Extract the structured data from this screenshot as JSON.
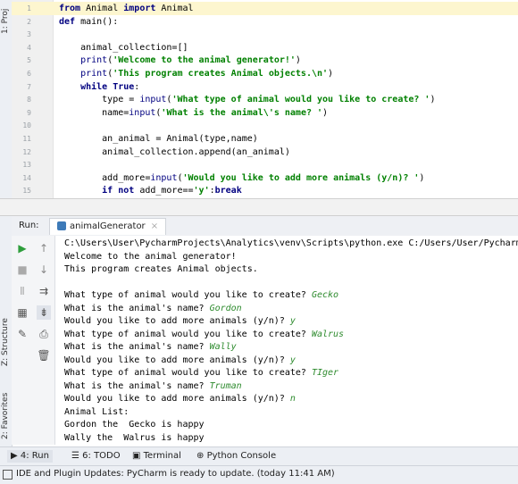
{
  "left_tabs": {
    "project": "1: Proj",
    "structure": "Z: Structure",
    "favorites": "2: Favorites"
  },
  "editor": {
    "lines": [
      {
        "num": "1",
        "parts": [
          [
            "kw",
            "from "
          ],
          [
            "",
            "Animal "
          ],
          [
            "kw",
            "import "
          ],
          [
            "",
            "Animal"
          ]
        ],
        "highlight": true
      },
      {
        "num": "2",
        "parts": [
          [
            "kw",
            "def "
          ],
          [
            "",
            "main():"
          ]
        ]
      },
      {
        "num": "3",
        "parts": []
      },
      {
        "num": "4",
        "parts": [
          [
            "",
            "    animal_collection=[]"
          ]
        ]
      },
      {
        "num": "5",
        "parts": [
          [
            "fn",
            "    print"
          ],
          [
            "",
            "("
          ],
          [
            "str",
            "'Welcome to the animal generator!'"
          ],
          [
            "",
            ")"
          ]
        ]
      },
      {
        "num": "6",
        "parts": [
          [
            "fn",
            "    print"
          ],
          [
            "",
            "("
          ],
          [
            "str",
            "'This program creates Animal objects.\\n'"
          ],
          [
            "",
            ")"
          ]
        ]
      },
      {
        "num": "7",
        "parts": [
          [
            "kw",
            "    while True"
          ],
          [
            "",
            ":"
          ]
        ]
      },
      {
        "num": "8",
        "parts": [
          [
            "",
            "        type = "
          ],
          [
            "fn",
            "input"
          ],
          [
            "",
            "("
          ],
          [
            "str",
            "'What type of animal would you like to create? '"
          ],
          [
            "",
            ")"
          ]
        ]
      },
      {
        "num": "9",
        "parts": [
          [
            "",
            "        name="
          ],
          [
            "fn",
            "input"
          ],
          [
            "",
            "("
          ],
          [
            "str",
            "'What is the animal\\'s name? '"
          ],
          [
            "",
            ")"
          ]
        ]
      },
      {
        "num": "10",
        "parts": []
      },
      {
        "num": "11",
        "parts": [
          [
            "",
            "        an_animal = Animal(type,name)"
          ]
        ]
      },
      {
        "num": "12",
        "parts": [
          [
            "",
            "        animal_collection.append(an_animal)"
          ]
        ]
      },
      {
        "num": "13",
        "parts": []
      },
      {
        "num": "14",
        "parts": [
          [
            "",
            "        add_more="
          ],
          [
            "fn",
            "input"
          ],
          [
            "",
            "("
          ],
          [
            "str",
            "'Would you like to add more animals (y/n)? '"
          ],
          [
            "",
            ")"
          ]
        ]
      },
      {
        "num": "15",
        "parts": [
          [
            "kw",
            "        if not "
          ],
          [
            "",
            "add_more=="
          ],
          [
            "str",
            "'y'"
          ],
          [
            "",
            ":"
          ],
          [
            "kw",
            "break"
          ]
        ]
      }
    ]
  },
  "run": {
    "label": "Run:",
    "tab_name": "animalGenerator"
  },
  "console": {
    "lines": [
      [
        [
          "",
          "C:\\Users\\User\\PycharmProjects\\Analytics\\venv\\Scripts\\python.exe C:/Users/User/Pycharm"
        ]
      ],
      [
        [
          "",
          "Welcome to the animal generator!"
        ]
      ],
      [
        [
          "",
          "This program creates Animal objects."
        ]
      ],
      [],
      [
        [
          "",
          "What type of animal would you like to create? "
        ],
        [
          "uin",
          "Gecko"
        ]
      ],
      [
        [
          "",
          "What is the animal's name? "
        ],
        [
          "uin",
          "Gordon"
        ]
      ],
      [
        [
          "",
          "Would you like to add more animals (y/n)? "
        ],
        [
          "uin",
          "y"
        ]
      ],
      [
        [
          "",
          "What type of animal would you like to create? "
        ],
        [
          "uin",
          "Walrus"
        ]
      ],
      [
        [
          "",
          "What is the animal's name? "
        ],
        [
          "uin",
          "Wally"
        ]
      ],
      [
        [
          "",
          "Would you like to add more animals (y/n)? "
        ],
        [
          "uin",
          "y"
        ]
      ],
      [
        [
          "",
          "What type of animal would you like to create? "
        ],
        [
          "uin",
          "TIger"
        ]
      ],
      [
        [
          "",
          "What is the animal's name? "
        ],
        [
          "uin",
          "Truman"
        ]
      ],
      [
        [
          "",
          "Would you like to add more animals (y/n)? "
        ],
        [
          "uin",
          "n"
        ]
      ],
      [
        [
          "",
          "Animal List:"
        ]
      ],
      [
        [
          "",
          "Gordon the  Gecko is happy"
        ]
      ],
      [
        [
          "",
          "Wally the  Walrus is happy"
        ]
      ]
    ]
  },
  "bottom_tabs": {
    "run": "4: Run",
    "todo": "6: TODO",
    "terminal": "Terminal",
    "python_console": "Python Console"
  },
  "status": {
    "message": "IDE and Plugin Updates: PyCharm is ready to update. (today 11:41 AM)"
  }
}
